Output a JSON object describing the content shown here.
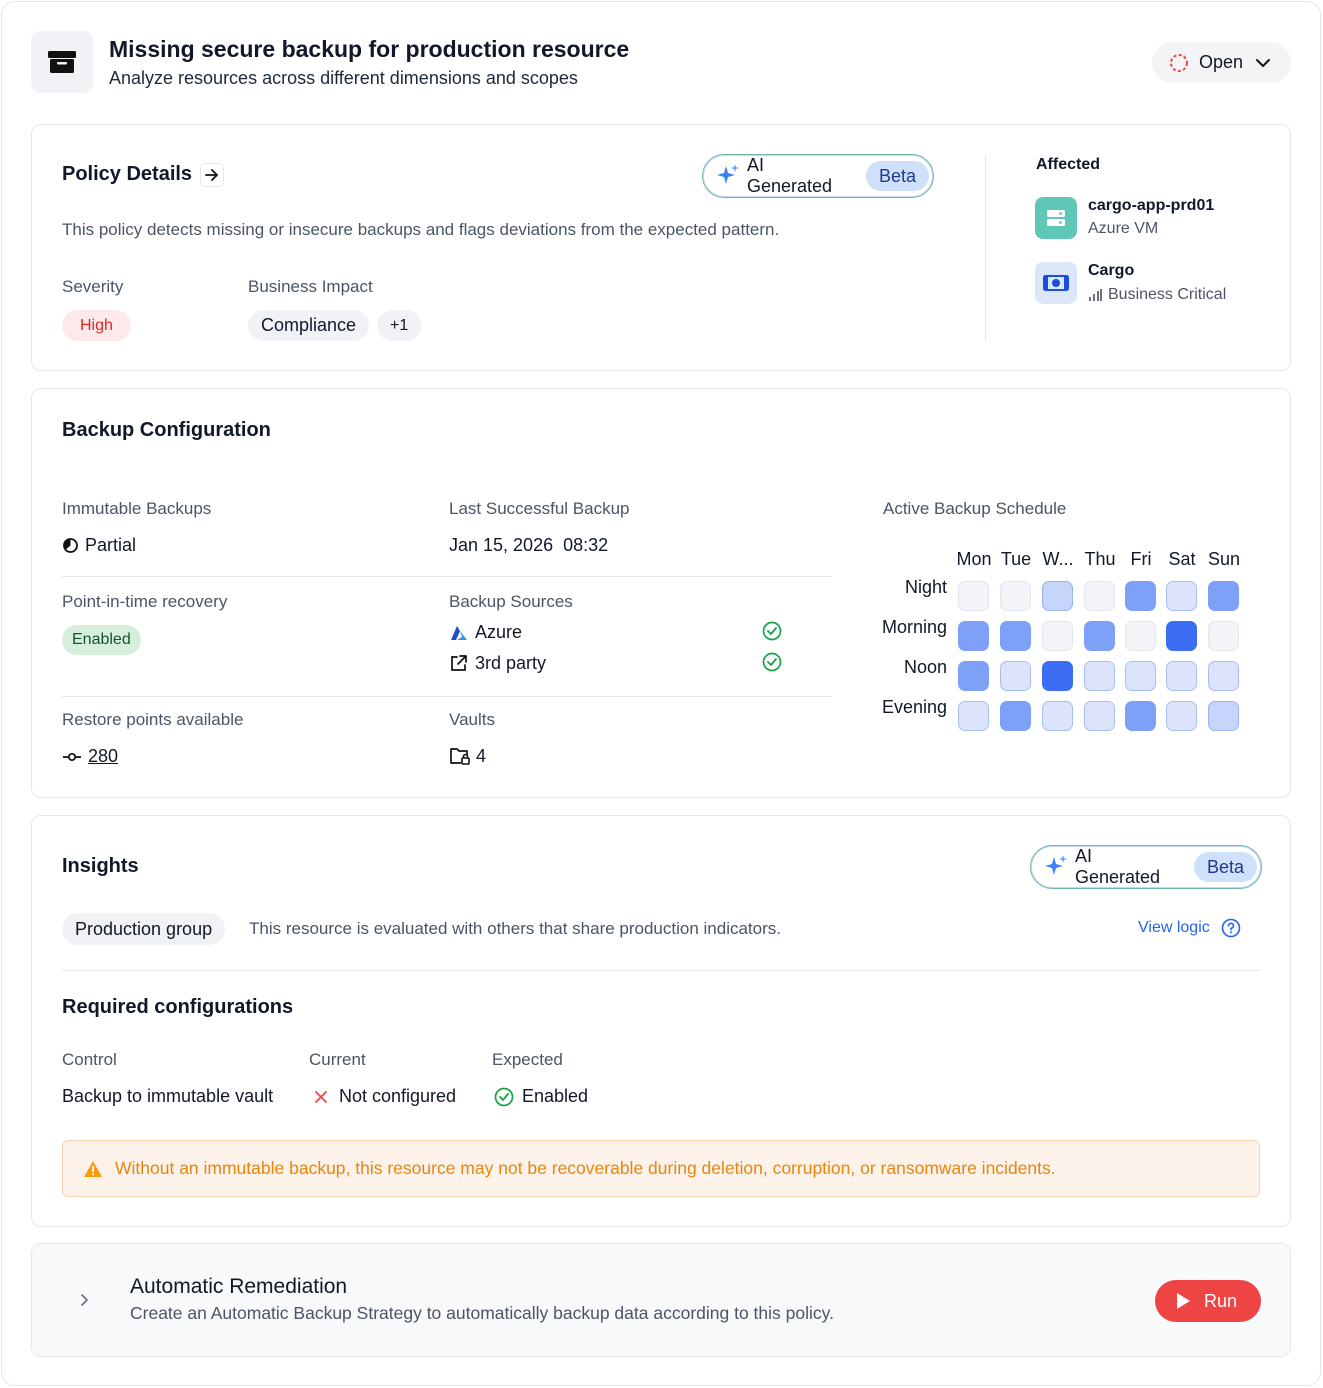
{
  "header": {
    "title": "Missing secure backup for production resource",
    "subtitle": "Analyze resources across different dimensions and scopes",
    "status_label": "Open"
  },
  "policy": {
    "title": "Policy Details",
    "ai_label": "AI Generated",
    "beta_label": "Beta",
    "description": "This policy detects missing or insecure backups and flags deviations from the expected pattern.",
    "severity_label": "Severity",
    "severity_value": "High",
    "impact_label": "Business Impact",
    "impact_value": "Compliance",
    "impact_more": "+1",
    "affected_label": "Affected",
    "affected": [
      {
        "name": "cargo-app-prd01",
        "sub": "Azure VM",
        "icon": "server-icon"
      },
      {
        "name": "Cargo",
        "sub": "Business Critical",
        "icon": "money-icon"
      }
    ]
  },
  "backup": {
    "title": "Backup Configuration",
    "immutable_label": "Immutable Backups",
    "immutable_value": "Partial",
    "last_label": "Last Successful Backup",
    "last_value": "Jan 15, 2026  08:32",
    "pitr_label": "Point-in-time recovery",
    "pitr_value": "Enabled",
    "sources_label": "Backup Sources",
    "sources": [
      "Azure",
      "3rd party"
    ],
    "restore_label": "Restore points available",
    "restore_value": "280",
    "vaults_label": "Vaults",
    "vaults_value": "4",
    "schedule": {
      "title": "Active Backup Schedule",
      "days": [
        "Mon",
        "Tue",
        "W...",
        "Thu",
        "Fri",
        "Sat",
        "Sun"
      ],
      "slots": [
        "Night",
        "Morning",
        "Noon",
        "Evening"
      ],
      "intensity": [
        [
          0,
          0,
          2,
          0,
          4,
          1,
          4
        ],
        [
          4,
          4,
          0,
          4,
          0,
          5,
          0
        ],
        [
          4,
          1,
          5,
          1,
          1,
          1,
          1
        ],
        [
          1,
          4,
          1,
          1,
          4,
          1,
          2
        ]
      ]
    }
  },
  "insights": {
    "title": "Insights",
    "ai_label": "AI Generated",
    "beta_label": "Beta",
    "group_chip": "Production group",
    "group_text": "This resource is evaluated with others that share production indicators.",
    "view_logic": "View logic",
    "required_title": "Required configurations",
    "col_control": "Control",
    "col_current": "Current",
    "col_expected": "Expected",
    "row_control": "Backup to immutable vault",
    "row_current": "Not configured",
    "row_expected": "Enabled",
    "warning": "Without an immutable backup, this resource may not be recoverable during deletion, corruption, or ransomware incidents."
  },
  "remediation": {
    "title": "Automatic Remediation",
    "description": "Create an Automatic Backup Strategy to automatically backup data according to this policy.",
    "run_label": "Run"
  },
  "colors": {
    "accent": "#3b6ef5",
    "danger": "#ef4444",
    "success": "#16a34a",
    "warning": "#e8860c"
  }
}
